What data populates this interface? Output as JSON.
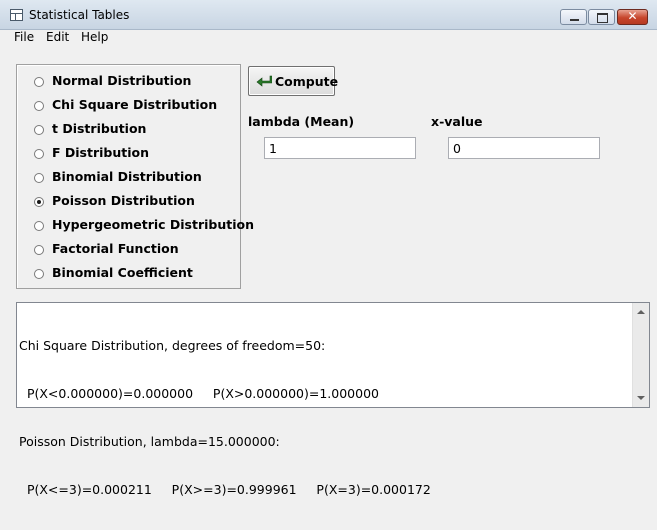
{
  "window": {
    "title": "Statistical Tables",
    "close_glyph": "✕"
  },
  "menu": {
    "items": [
      "File",
      "Edit",
      "Help"
    ]
  },
  "distributions": {
    "options": [
      {
        "label": "Normal Distribution",
        "checked": false
      },
      {
        "label": "Chi Square Distribution",
        "checked": false
      },
      {
        "label": "t Distribution",
        "checked": false
      },
      {
        "label": "F Distribution",
        "checked": false
      },
      {
        "label": "Binomial Distribution",
        "checked": false
      },
      {
        "label": "Poisson Distribution",
        "checked": true
      },
      {
        "label": "Hypergeometric Distribution",
        "checked": false
      },
      {
        "label": "Factorial Function",
        "checked": false
      },
      {
        "label": "Binomial Coefficient",
        "checked": false
      }
    ]
  },
  "toolbar": {
    "compute_label": "Compute",
    "compute_icon": "green-enter-arrow-icon"
  },
  "inputs": {
    "lambda_label": "lambda (Mean)",
    "lambda_value": "1",
    "x_label": "x-value",
    "x_value": "0"
  },
  "output": {
    "lines": [
      "Chi Square Distribution, degrees of freedom=50:",
      "  P(X<0.000000)=0.000000     P(X>0.000000)=1.000000",
      "Poisson Distribution, lambda=15.000000:",
      "  P(X<=3)=0.000211     P(X>=3)=0.999961     P(X=3)=0.000172"
    ]
  },
  "colors": {
    "accent_close": "#c7462c",
    "compute_arrow": "#2a7a2a"
  }
}
